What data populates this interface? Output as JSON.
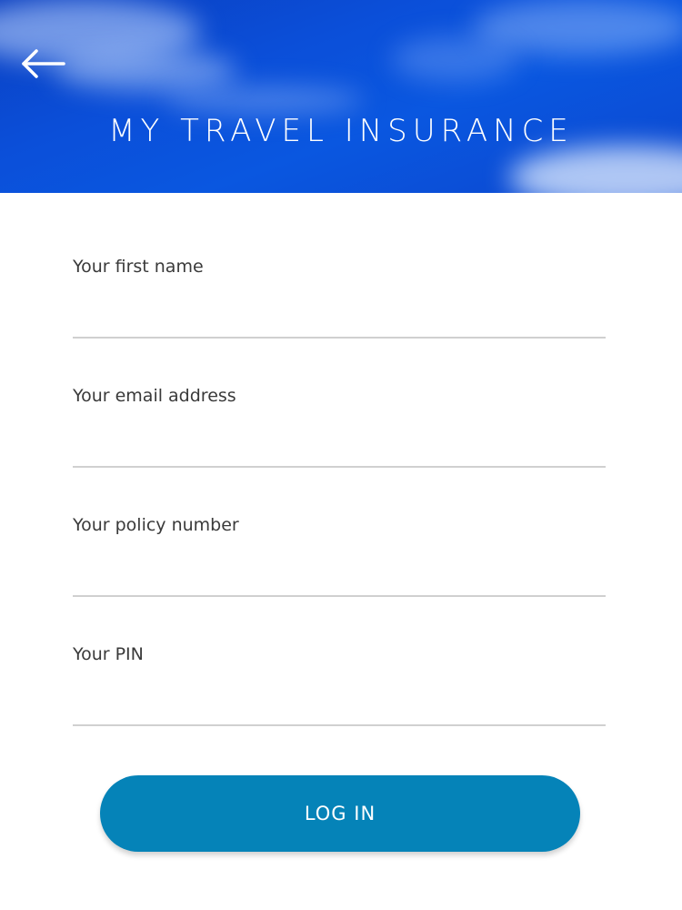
{
  "header": {
    "title": "MY TRAVEL INSURANCE",
    "back_icon": "arrow-left-icon",
    "background_color": "#0b4fd9"
  },
  "form": {
    "fields": [
      {
        "label": "Your first name",
        "value": ""
      },
      {
        "label": "Your email address",
        "value": ""
      },
      {
        "label": "Your policy number",
        "value": ""
      },
      {
        "label": "Your PIN",
        "value": ""
      }
    ]
  },
  "actions": {
    "login_label": "LOG IN",
    "login_color": "#0583b8"
  }
}
